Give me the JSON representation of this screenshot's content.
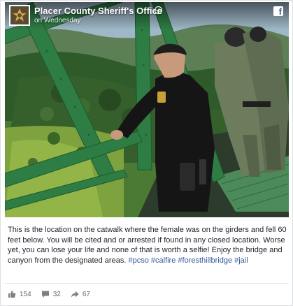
{
  "header": {
    "page_name": "Placer County Sheriff's Office",
    "post_time": "on Wednesday",
    "platform_icon": "facebook-icon",
    "verified_icon": "verified-icon"
  },
  "photo": {
    "description_icon": "photo"
  },
  "caption": {
    "text": "This is the location on the catwalk where the female was on the girders and fell 60 feet below. You will be cited and or arrested if found in any closed location. Worse yet, you can lose your life and none of that is worth a selfie! Enjoy the bridge and canyon from the designated areas.",
    "hashtags": [
      "#pcso",
      "#calfire",
      "#foresthillbridge",
      "#jail"
    ]
  },
  "actions": {
    "likes": "154",
    "comments": "32",
    "shares": "67",
    "like_icon": "thumbs-up-icon",
    "comment_icon": "comment-icon",
    "share_icon": "share-icon"
  },
  "colors": {
    "hashtag": "#365899",
    "text": "#1d2129",
    "meta": "#606770",
    "bridge_green": "#2e7d44"
  }
}
